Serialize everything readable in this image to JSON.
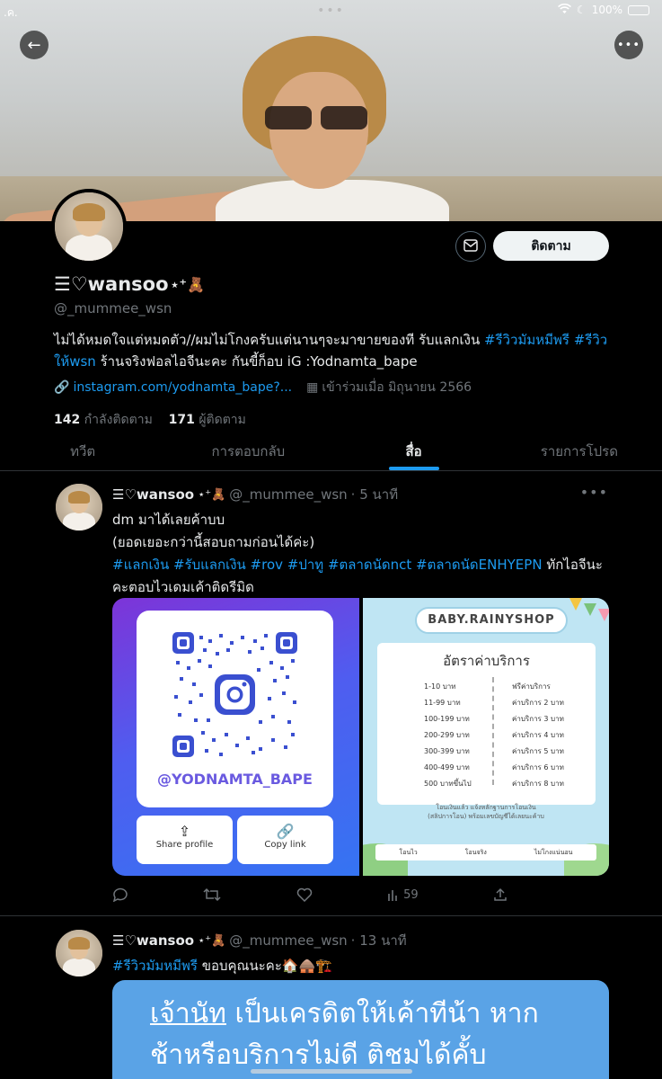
{
  "status_bar": {
    "left": ".ค.",
    "battery_text": "100%"
  },
  "profile": {
    "display_name": "☰♡wansoo",
    "name_decoration": "⋆⁺🧸",
    "handle": "@_mummee_wsn",
    "bio_text_1": "ไม่ได้หมดใจแต่หมดตัว//ผมไม่โกงครับแต่นานๆจะมาขายของที รับแลกเงิน ",
    "bio_tag_1": "#รีวิวมัมหมีพรี",
    "bio_tag_2": "#รีวิว",
    "bio_tag_3": "ให้wsn",
    "bio_text_2": " ร้านจริงฟอลไอจีนะคะ กันขี้ก็อบ iG :Yodnamta_bape",
    "website": "instagram.com/yodnamta_bape?...",
    "joined": "เข้าร่วมเมื่อ มิถุนายน 2566",
    "following_count": "142",
    "following_label": "กำลังติดตาม",
    "followers_count": "171",
    "followers_label": "ผู้ติดตาม",
    "follow_button": "ติดตาม"
  },
  "tabs": [
    {
      "label": "ทวีต"
    },
    {
      "label": "การตอบกลับ"
    },
    {
      "label": "สื่อ"
    },
    {
      "label": "รายการโปรด"
    }
  ],
  "tweet1": {
    "name": "☰♡wansoo",
    "deco": "⋆⁺🧸",
    "handle": "@_mummee_wsn",
    "time": "· 5 นาที",
    "line1": "dm มาได้เลยค้าบบ",
    "line2": "(ยอดเยอะกว่านี้สอบถามก่อนได้ค่ะ)",
    "tags": "#แลกเงิน #รับแลกเงิน #rov #ปาทู #ตลาดนัดnct #ตลาดนัดENHYEPN",
    "tail": " ทักไอจีนะคะตอบไวเดมเค้าติดรีมิด",
    "qr_name": "@YODNAMTA_BAPE",
    "share_label": "Share profile",
    "copy_label": "Copy link",
    "shop_name": "BABY.RAINYSHOP",
    "rate_title": "อัตราค่าบริการ",
    "rates": [
      {
        "range": "1-10 บาท",
        "fee": "ฟรีค่าบริการ"
      },
      {
        "range": "11-99 บาท",
        "fee": "ค่าบริการ 2 บาท"
      },
      {
        "range": "100-199 บาท",
        "fee": "ค่าบริการ 3 บาท"
      },
      {
        "range": "200-299 บาท",
        "fee": "ค่าบริการ 4 บาท"
      },
      {
        "range": "300-399 บาท",
        "fee": "ค่าบริการ 5 บาท"
      },
      {
        "range": "400-499 บาท",
        "fee": "ค่าบริการ 6 บาท"
      },
      {
        "range": "500 บาทขึ้นไป",
        "fee": "ค่าบริการ 8 บาท"
      }
    ],
    "rate_note_1": "โอนเงินแล้ว แจ้งหลักฐานการโอนเงิน",
    "rate_note_2": "(สลิปการโอน) พร้อมเลขบัญชีได้เลยนะค้าบ",
    "rate_bar": [
      "โอนไว",
      "โอนจริง",
      "ไม่โกงแน่นอน"
    ],
    "views": "59"
  },
  "tweet2": {
    "name": "☰♡wansoo",
    "deco": "⋆⁺🧸",
    "handle": "@_mummee_wsn",
    "time": "· 13 นาที",
    "tag": "#รีวิวมัมหมีพรี",
    "text": " ขอบคุณนะคะ🏠🛖🏗️",
    "img_line1_u": "เจ้านัท",
    "img_line1": " เป็นเครดิตให้เค้าทีน้า หาก",
    "img_line2": "ช้าหรือบริการไม่ดี ติชมได้คั้บ"
  }
}
